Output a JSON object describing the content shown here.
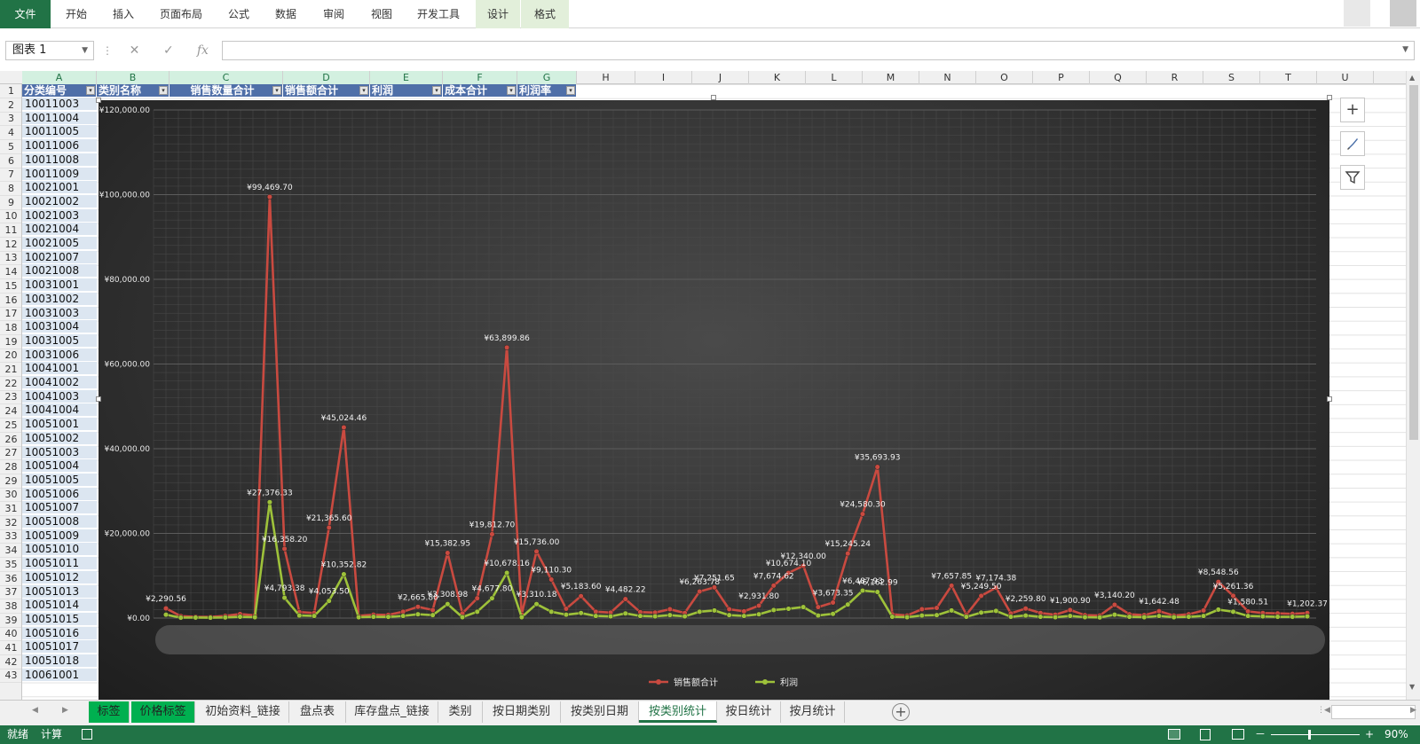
{
  "ribbon": {
    "tabs": [
      "文件",
      "开始",
      "插入",
      "页面布局",
      "公式",
      "数据",
      "审阅",
      "视图",
      "开发工具",
      "设计",
      "格式"
    ]
  },
  "formula_bar": {
    "name_box": "图表 1",
    "cancel_icon": "✕",
    "enter_icon": "✓",
    "fx_label": "fx",
    "value": ""
  },
  "columns": [
    "A",
    "B",
    "C",
    "D",
    "E",
    "F",
    "G",
    "H",
    "I",
    "J",
    "K",
    "L",
    "M",
    "N",
    "O",
    "P",
    "Q",
    "R",
    "S",
    "T",
    "U"
  ],
  "rows": [
    "1",
    "2",
    "3",
    "4",
    "5",
    "6",
    "7",
    "8",
    "9",
    "10",
    "11",
    "12",
    "13",
    "14",
    "15",
    "16",
    "17",
    "18",
    "19",
    "20",
    "21",
    "22",
    "23",
    "24",
    "25",
    "26",
    "27",
    "28",
    "29",
    "30",
    "31",
    "32",
    "33",
    "34",
    "35",
    "36",
    "37",
    "38",
    "39",
    "40",
    "41",
    "42",
    "43"
  ],
  "header_row": [
    "分类编号",
    "类别名称",
    "销售数量合计",
    "销售额合计",
    "利润",
    "成本合计",
    "利润率"
  ],
  "col_a": [
    "10011003",
    "10011004",
    "10011005",
    "10011006",
    "10011008",
    "10011009",
    "10021001",
    "10021002",
    "10021003",
    "10021004",
    "10021005",
    "10021007",
    "10021008",
    "10031001",
    "10031002",
    "10031003",
    "10031004",
    "10031005",
    "10031006",
    "10041001",
    "10041002",
    "10041003",
    "10041004",
    "10051001",
    "10051002",
    "10051003",
    "10051004",
    "10051005",
    "10051006",
    "10051007",
    "10051008",
    "10051009",
    "10051010",
    "10051011",
    "10051012",
    "10051013",
    "10051014",
    "10051015",
    "10051016",
    "10051017",
    "10051018",
    "10061001"
  ],
  "chart_data": {
    "type": "line",
    "ylim": [
      0,
      120000
    ],
    "yticks": [
      "¥0.00",
      "¥20,000.00",
      "¥40,000.00",
      "¥60,000.00",
      "¥80,000.00",
      "¥100,000.00",
      "¥120,000.00"
    ],
    "grid": true,
    "legend_position": "bottom",
    "series": [
      {
        "name": "销售额合计",
        "color": "#c94a40",
        "values": [
          2290.56,
          471,
          320,
          280,
          520,
          954,
          650,
          99469.7,
          16358.2,
          1430,
          1200,
          21365.6,
          45024.46,
          550,
          800,
          760,
          1500,
          2665.8,
          1900,
          15382.95,
          1100,
          4677.8,
          19812.7,
          63899.86,
          850,
          15736,
          9110.3,
          2200,
          5183.6,
          1500,
          1300,
          4482.22,
          1400,
          1300,
          2100,
          1200,
          6263.78,
          7251.65,
          2100,
          1600,
          2931.8,
          7674.62,
          10674.1,
          12340,
          2600,
          3673.35,
          15245.24,
          24580.3,
          35693.93,
          900,
          600,
          2100,
          2400,
          7657.85,
          800,
          5249.5,
          7174.38,
          1100,
          2259.8,
          1200,
          800,
          1900.9,
          700,
          600,
          3140.2,
          900,
          700,
          1642.48,
          600,
          900,
          1800,
          8548.56,
          5261.36,
          1580.51,
          1200,
          1100,
          1000,
          1202.37
        ]
      },
      {
        "name": "利润",
        "color": "#9ec23a",
        "values": [
          800,
          100,
          120,
          90,
          150,
          300,
          200,
          27376.33,
          4793.38,
          600,
          500,
          4053.5,
          10352.82,
          200,
          300,
          280,
          500,
          900,
          700,
          3308.98,
          200,
          1500,
          4677.8,
          10678.16,
          200,
          3310.18,
          1500,
          800,
          1200,
          500,
          400,
          1100,
          500,
          400,
          700,
          400,
          1500,
          1800,
          700,
          500,
          900,
          1900,
          2200,
          2600,
          600,
          1000,
          3200,
          6487.93,
          6162.99,
          300,
          200,
          600,
          700,
          1800,
          300,
          1300,
          1700,
          300,
          600,
          300,
          200,
          500,
          200,
          150,
          800,
          300,
          200,
          500,
          200,
          300,
          500,
          2000,
          1500,
          500,
          400,
          300,
          300,
          400
        ]
      }
    ],
    "visible_labels": [
      {
        "series": 0,
        "i": 0,
        "text": "¥2,290.56"
      },
      {
        "series": 0,
        "i": 7,
        "text": "¥99,469.70"
      },
      {
        "series": 0,
        "i": 8,
        "text": "¥16,358.20"
      },
      {
        "series": 0,
        "i": 11,
        "text": "¥21,365.60"
      },
      {
        "series": 0,
        "i": 12,
        "text": "¥45,024.46"
      },
      {
        "series": 0,
        "i": 17,
        "text": "¥2,665.80"
      },
      {
        "series": 0,
        "i": 19,
        "text": "¥15,382.95"
      },
      {
        "series": 0,
        "i": 22,
        "text": "¥19,812.70"
      },
      {
        "series": 0,
        "i": 23,
        "text": "¥63,899.86"
      },
      {
        "series": 0,
        "i": 25,
        "text": "¥15,736.00"
      },
      {
        "series": 0,
        "i": 26,
        "text": "¥9,110.30"
      },
      {
        "series": 0,
        "i": 28,
        "text": "¥5,183.60"
      },
      {
        "series": 0,
        "i": 31,
        "text": "¥4,482.22"
      },
      {
        "series": 0,
        "i": 36,
        "text": "¥6,263.78"
      },
      {
        "series": 0,
        "i": 37,
        "text": "¥7,251.65"
      },
      {
        "series": 0,
        "i": 40,
        "text": "¥2,931.80"
      },
      {
        "series": 0,
        "i": 41,
        "text": "¥7,674.62"
      },
      {
        "series": 0,
        "i": 42,
        "text": "¥10,674.10"
      },
      {
        "series": 0,
        "i": 43,
        "text": "¥12,340.00"
      },
      {
        "series": 0,
        "i": 45,
        "text": "¥3,673.35"
      },
      {
        "series": 0,
        "i": 46,
        "text": "¥15,245.24"
      },
      {
        "series": 0,
        "i": 47,
        "text": "¥24,580.30"
      },
      {
        "series": 0,
        "i": 48,
        "text": "¥35,693.93"
      },
      {
        "series": 0,
        "i": 53,
        "text": "¥7,657.85"
      },
      {
        "series": 0,
        "i": 55,
        "text": "¥5,249.50"
      },
      {
        "series": 0,
        "i": 56,
        "text": "¥7,174.38"
      },
      {
        "series": 0,
        "i": 58,
        "text": "¥2,259.80"
      },
      {
        "series": 0,
        "i": 61,
        "text": "¥1,900.90"
      },
      {
        "series": 0,
        "i": 64,
        "text": "¥3,140.20"
      },
      {
        "series": 0,
        "i": 67,
        "text": "¥1,642.48"
      },
      {
        "series": 0,
        "i": 71,
        "text": "¥8,548.56"
      },
      {
        "series": 0,
        "i": 72,
        "text": "¥5,261.36"
      },
      {
        "series": 0,
        "i": 73,
        "text": "¥1,580.51"
      },
      {
        "series": 0,
        "i": 77,
        "text": "¥1,202.37"
      },
      {
        "series": 1,
        "i": 7,
        "text": "¥27,376.33"
      },
      {
        "series": 1,
        "i": 8,
        "text": "¥4,793.38"
      },
      {
        "series": 1,
        "i": 11,
        "text": "¥4,053.50"
      },
      {
        "series": 1,
        "i": 12,
        "text": "¥10,352.82"
      },
      {
        "series": 1,
        "i": 19,
        "text": "¥3,308.98"
      },
      {
        "series": 1,
        "i": 22,
        "text": "¥4,677.80"
      },
      {
        "series": 1,
        "i": 23,
        "text": "¥10,678.16"
      },
      {
        "series": 1,
        "i": 25,
        "text": "¥3,310.18"
      },
      {
        "series": 1,
        "i": 47,
        "text": "¥6,487.93"
      },
      {
        "series": 1,
        "i": 48,
        "text": "¥6,162.99"
      }
    ]
  },
  "sheet_tabs": [
    "标签",
    "价格标签",
    "初始资料_链接",
    "盘点表",
    "库存盘点_链接",
    "类别",
    "按日期类别",
    "按类别日期",
    "按类别统计",
    "按日统计",
    "按月统计"
  ],
  "active_sheet": "按类别统计",
  "status": {
    "ready": "就绪",
    "calc": "计算",
    "zoom": "90%",
    "zoom_minus": "－",
    "zoom_plus": "+"
  },
  "icons": {
    "chart_elements": "plus-icon",
    "chart_styles": "brush-icon",
    "chart_filters": "filter-icon"
  }
}
